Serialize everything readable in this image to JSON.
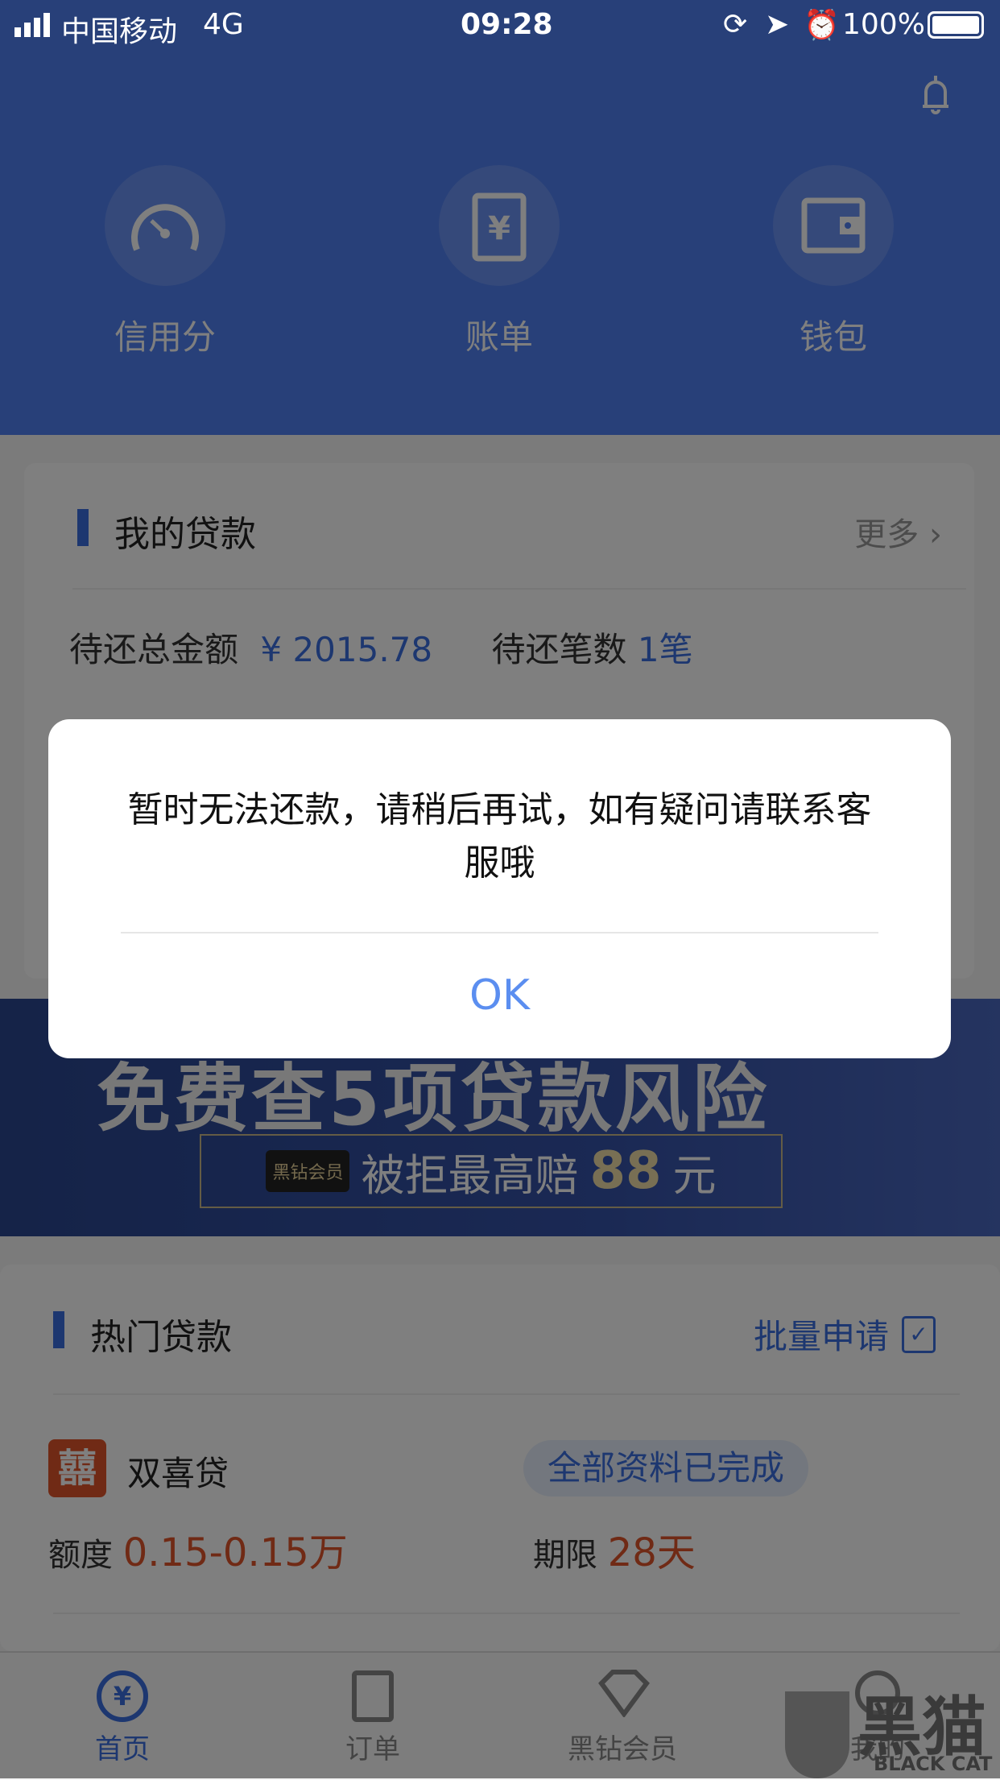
{
  "status_bar": {
    "carrier": "中国移动",
    "network": "4G",
    "time": "09:28",
    "battery": "100%"
  },
  "header": {
    "color": "#5080f2",
    "quick_links": [
      {
        "label": "信用分",
        "icon": "speedometer-icon"
      },
      {
        "label": "账单",
        "icon": "bill-yuan-icon"
      },
      {
        "label": "钱包",
        "icon": "wallet-icon"
      }
    ]
  },
  "my_loans": {
    "title": "我的贷款",
    "more": "更多",
    "total_label": "待还总金额",
    "total_value": "¥ 2015.78",
    "count_label": "待还笔数",
    "count_value": "1笔"
  },
  "banner": {
    "headline": "免费查5项贷款风险",
    "sub_badge": "黑钻会员",
    "sub_text": "被拒最高赔",
    "sub_amount": "88",
    "sub_unit": "元"
  },
  "hot_loans": {
    "title": "热门贷款",
    "batch_apply": "批量申请",
    "items": [
      {
        "logo_text": "囍",
        "name": "双喜贷",
        "status": "全部资料已完成",
        "amount_label": "额度",
        "amount_value": "0.15-0.15万",
        "term_label": "期限",
        "term_value": "28天"
      }
    ]
  },
  "tabbar": {
    "items": [
      {
        "label": "首页",
        "active": true
      },
      {
        "label": "订单"
      },
      {
        "label": "黑钻会员"
      },
      {
        "label": "我的"
      }
    ]
  },
  "dialog": {
    "message": "暂时无法还款，请稍后再试，如有疑问请联系客服哦",
    "ok": "OK"
  },
  "watermark": {
    "text": "黑猫",
    "sub": "BLACK CAT"
  },
  "colors": {
    "accent": "#3a6fe0",
    "orange": "#e0552b",
    "ok": "#5b8ef0"
  }
}
